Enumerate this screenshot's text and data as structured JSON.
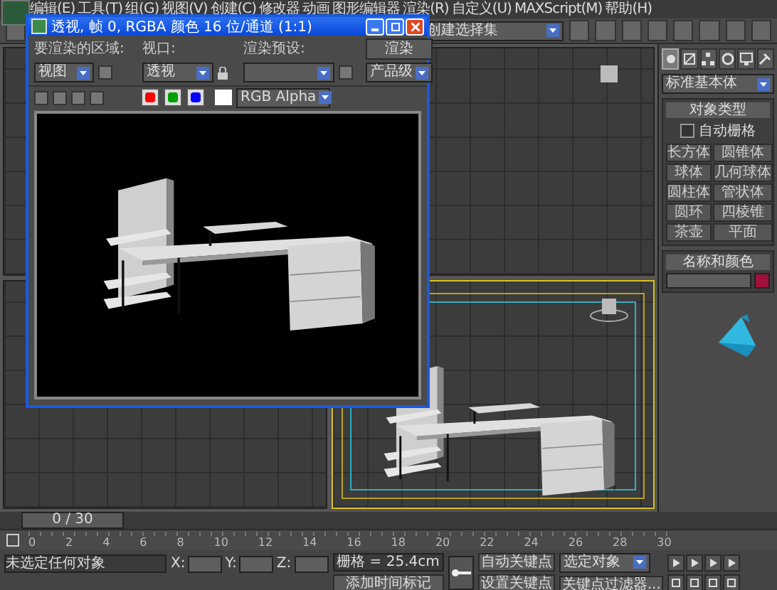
{
  "menu_bar": {
    "items": [
      "编辑(E)",
      "工具(T)",
      "组(G)",
      "视图(V)",
      "创建(C)",
      "修改器",
      "动画",
      "图形编辑器",
      "渲染(R)",
      "自定义(U)",
      "MAXScript(M)",
      "帮助(H)"
    ]
  },
  "main_toolbar": {
    "selection_set": "创建选择集"
  },
  "render_window": {
    "title": "透视, 帧 0, RGBA 颜色 16 位/通道 (1:1)",
    "area_label": "要渲染的区域:",
    "area_value": "视图",
    "viewport_label": "视口:",
    "viewport_value": "透视",
    "preset_label": "渲染预设:",
    "render_button": "渲染",
    "quality_value": "产品级",
    "channel_value": "RGB Alpha",
    "channels": [
      {
        "color": "#ff0000",
        "on": true
      },
      {
        "color": "#00a000",
        "on": true
      },
      {
        "color": "#0000ff",
        "on": true
      }
    ]
  },
  "command_panel": {
    "tabs": [
      {
        "kind": "create",
        "selected": true
      },
      {
        "kind": "modify",
        "selected": false
      },
      {
        "kind": "hierarchy",
        "selected": false
      },
      {
        "kind": "motion",
        "selected": false
      },
      {
        "kind": "display",
        "selected": false
      },
      {
        "kind": "utilities",
        "selected": false
      }
    ],
    "category": "标准基本体",
    "object_type_title": "对象类型",
    "autogrid": {
      "label": "自动栅格",
      "checked": false
    },
    "buttons": [
      "长方体",
      "圆锥体",
      "球体",
      "几何球体",
      "圆柱体",
      "管状体",
      "圆环",
      "四棱锥",
      "茶壶",
      "平面"
    ],
    "name_color_title": "名称和颜色",
    "object": {
      "color": "#a0103a"
    }
  },
  "timeline": {
    "frame": "0 / 30",
    "ticks": [
      "0",
      "2",
      "4",
      "6",
      "8",
      "10",
      "12",
      "14",
      "16",
      "18",
      "20",
      "22",
      "24",
      "26",
      "28",
      "30"
    ]
  },
  "status_bar": {
    "prompt": "未选定任何对象",
    "x_label": "X:",
    "y_label": "Y:",
    "z_label": "Z:",
    "grid": "栅格 = 25.4cm",
    "add_time_tag": "添加时间标记",
    "auto_key": "自动关键点",
    "set_key": "设置关键点",
    "key_mode": "选定对象",
    "key_filters": "关键点过滤器..."
  }
}
